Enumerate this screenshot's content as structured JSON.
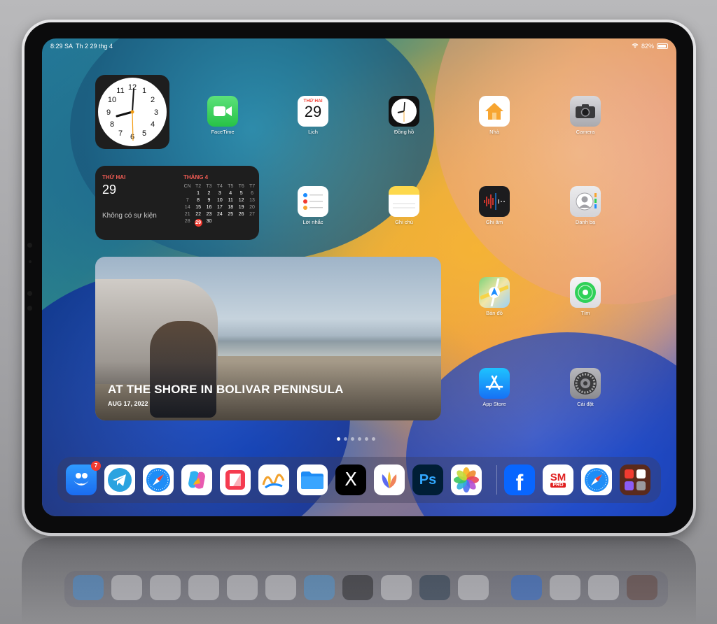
{
  "status_bar": {
    "time": "8:29 SA",
    "date": "Th 2 29 thg 4",
    "battery": "82%"
  },
  "calendar_widget": {
    "day_name": "THỨ HAI",
    "day_number": "29",
    "no_events": "Không có sự kiện",
    "month": "THÁNG 4",
    "weekday_headers": [
      "CN",
      "T2",
      "T3",
      "T4",
      "T5",
      "T6",
      "T7"
    ],
    "days": [
      "",
      "1",
      "2",
      "3",
      "4",
      "5",
      "6",
      "7",
      "8",
      "9",
      "10",
      "11",
      "12",
      "13",
      "14",
      "15",
      "16",
      "17",
      "18",
      "19",
      "20",
      "21",
      "22",
      "23",
      "24",
      "25",
      "26",
      "27",
      "28",
      "29",
      "30",
      "",
      "",
      "",
      ""
    ]
  },
  "photo_widget": {
    "title": "AT THE SHORE IN BOLIVAR PENINSULA",
    "date": "AUG 17, 2022"
  },
  "apps": {
    "facetime": "FaceTime",
    "calendar": "Lịch",
    "calendar_day": "THỨ HAI",
    "calendar_num": "29",
    "clock": "Đồng hồ",
    "home": "Nhà",
    "camera": "Camera",
    "reminders": "Lời nhắc",
    "notes": "Ghi chú",
    "voice_memos": "Ghi âm",
    "contacts": "Danh bạ",
    "maps": "Bản đồ",
    "find_my": "Tìm",
    "app_store": "App Store",
    "settings": "Cài đặt"
  },
  "dock": {
    "badge_count": "7",
    "items": [
      "Hello app",
      "Telegram",
      "Safari",
      "Copilot",
      "News",
      "Freeform",
      "Files",
      "X",
      "Frame",
      "Photoshop",
      "Photos",
      "Facebook",
      "SM Pro",
      "Safari",
      "App folder"
    ],
    "photoshop_text": "Ps",
    "x_text": "X",
    "facebook_text": "f",
    "smpro_top": "SM",
    "smpro_bottom": "PRO"
  },
  "colors": {
    "accent_red": "#f23b30",
    "facetime_green": "#2fd158",
    "appstore_blue": "#1a8cff"
  }
}
